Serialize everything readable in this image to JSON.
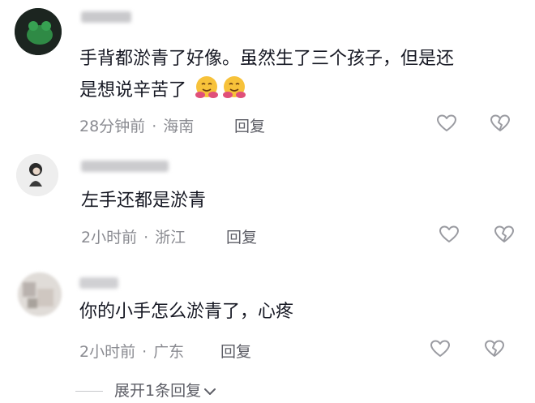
{
  "comments": [
    {
      "text_line1": "手背都淤青了好像。虽然生了三个孩子，但是还",
      "text_line2": "是想说辛苦了",
      "emoji_1": "hugging-face-emoji",
      "emoji_2": "hugging-face-emoji",
      "time": "28分钟前",
      "separator": "·",
      "location": "海南",
      "reply": "回复"
    },
    {
      "text": "左手还都是淤青",
      "time": "2小时前",
      "separator": "·",
      "location": "浙江",
      "reply": "回复"
    },
    {
      "text": "你的小手怎么淤青了，心疼",
      "time": "2小时前",
      "separator": "·",
      "location": "广东",
      "reply": "回复"
    }
  ],
  "expand_replies": "展开1条回复",
  "icons": {
    "like": "heart-outline-icon",
    "dislike": "broken-heart-icon",
    "expand": "chevron-down-icon"
  },
  "colors": {
    "text": "#161823",
    "meta": "#8a8b91",
    "icon": "#9a9ba1"
  }
}
